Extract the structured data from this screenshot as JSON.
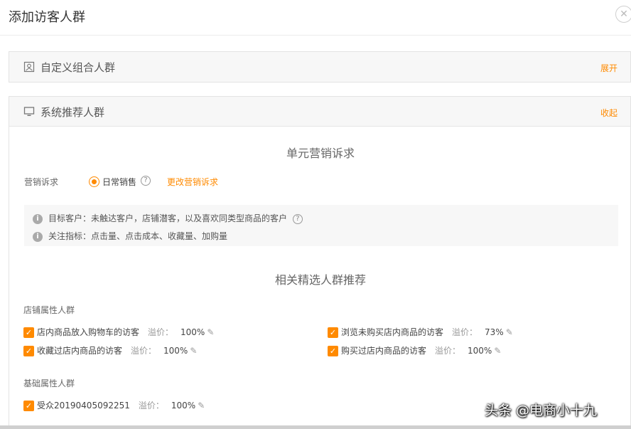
{
  "dialog": {
    "title": "添加访客人群",
    "close_icon": "close-icon"
  },
  "custom_panel": {
    "title": "自定义组合人群",
    "toggle_label": "展开",
    "icon": "image-icon"
  },
  "system_panel": {
    "title": "系统推荐人群",
    "toggle_label": "收起",
    "icon": "monitor-icon",
    "marketing_section_title": "单元营销诉求",
    "marketing_label": "营销诉求",
    "marketing_option": "日常销售",
    "change_link": "更改营销诉求",
    "info": {
      "target_label": "目标客户：",
      "target_text": "未触达客户，店铺潜客，以及喜欢同类型商品的客户",
      "focus_label": "关注指标：",
      "focus_text": "点击量、点击成本、收藏量、加购量"
    },
    "recommend_section_title": "相关精选人群推荐",
    "premium_label": "溢价：",
    "store_group": {
      "label": "店铺属性人群",
      "items": [
        {
          "name": "店内商品放入购物车的访客",
          "premium": "100%",
          "checked": true
        },
        {
          "name": "浏览未购买店内商品的访客",
          "premium": "73%",
          "checked": true
        },
        {
          "name": "收藏过店内商品的访客",
          "premium": "100%",
          "checked": true
        },
        {
          "name": "购买过店内商品的访客",
          "premium": "100%",
          "checked": true
        }
      ]
    },
    "basic_group": {
      "label": "基础属性人群",
      "items": [
        {
          "name": "受众20190405092251",
          "premium": "100%",
          "checked": true
        }
      ]
    }
  },
  "watermark": "头条 @电商小十九",
  "colors": {
    "accent": "#ff8a00",
    "panel_header_bg": "#f7f7f7",
    "info_bg": "#f7f7f7"
  }
}
